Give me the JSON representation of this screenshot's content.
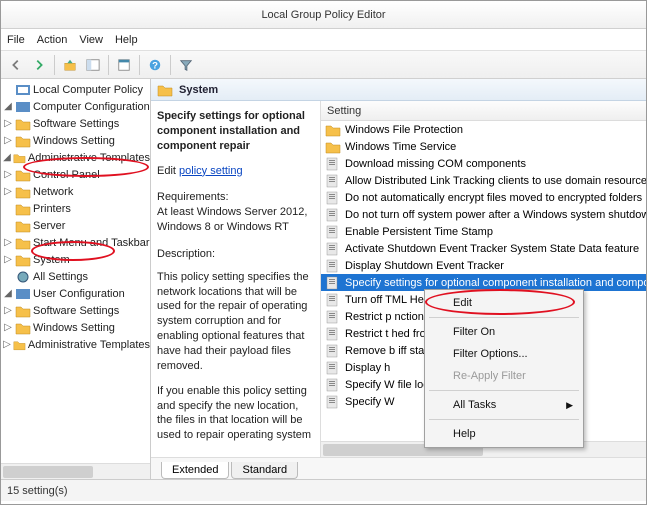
{
  "title": "Local Group Policy Editor",
  "menu": {
    "file": "File",
    "action": "Action",
    "view": "View",
    "help": "Help"
  },
  "tree": {
    "root": "Local Computer Policy",
    "cc": "Computer Configuration",
    "cc_ss": "Software Settings",
    "cc_ws": "Windows Setting",
    "cc_at": "Administrative Templates",
    "cc_at_cp": "Control Panel",
    "cc_at_nw": "Network",
    "cc_at_pr": "Printers",
    "cc_at_sv": "Server",
    "cc_at_sm": "Start Menu and Taskbar",
    "cc_at_sy": "System",
    "cc_at_all": "All Settings",
    "uc": "User Configuration",
    "uc_ss": "Software Settings",
    "uc_ws": "Windows Setting",
    "uc_at": "Administrative Templates"
  },
  "category": "System",
  "desc": {
    "title": "Specify settings for optional component installation and component repair",
    "editlabel": "Edit ",
    "editlink": "policy setting",
    "req_h": "Requirements:",
    "req_b": "At least Windows Server 2012, Windows 8 or Windows RT",
    "desc_h": "Description:",
    "p1": "This policy setting specifies the network locations that will be used for the repair of operating system corruption and for enabling optional features that have had their payload files removed.",
    "p2": "If you enable this policy setting and specify the new location, the files in that location will be used to repair operating system"
  },
  "list": {
    "header": "Setting",
    "items": [
      {
        "t": "folder",
        "l": "Windows File Protection"
      },
      {
        "t": "folder",
        "l": "Windows Time Service"
      },
      {
        "t": "policy",
        "l": "Download missing COM components"
      },
      {
        "t": "policy",
        "l": "Allow Distributed Link Tracking clients to use domain resources"
      },
      {
        "t": "policy",
        "l": "Do not automatically encrypt files moved to encrypted folders"
      },
      {
        "t": "policy",
        "l": "Do not turn off system power after a Windows system shutdown"
      },
      {
        "t": "policy",
        "l": "Enable Persistent Time Stamp"
      },
      {
        "t": "policy",
        "l": "Activate Shutdown Event Tracker System State Data feature"
      },
      {
        "t": "policy",
        "l": "Display Shutdown Event Tracker"
      },
      {
        "t": "policy",
        "l": "Specify settings for optional component installation and component repair",
        "sel": true
      },
      {
        "t": "policy",
        "l": "Turn off                                           TML Help Execution"
      },
      {
        "t": "policy",
        "l": "Restrict p                                          nctions to syst"
      },
      {
        "t": "policy",
        "l": "Restrict t                                          hed from Help"
      },
      {
        "t": "policy",
        "l": "Remove b                                          iff status messages"
      },
      {
        "t": "policy",
        "l": "Display h"
      },
      {
        "t": "policy",
        "l": "Specify W                                          file location"
      },
      {
        "t": "policy",
        "l": "Specify W"
      }
    ]
  },
  "tabs": {
    "ext": "Extended",
    "std": "Standard"
  },
  "status": "15 setting(s)",
  "ctx": {
    "edit": "Edit",
    "fon": "Filter On",
    "fopt": "Filter Options...",
    "reap": "Re-Apply Filter",
    "alltasks": "All Tasks",
    "help": "Help"
  }
}
